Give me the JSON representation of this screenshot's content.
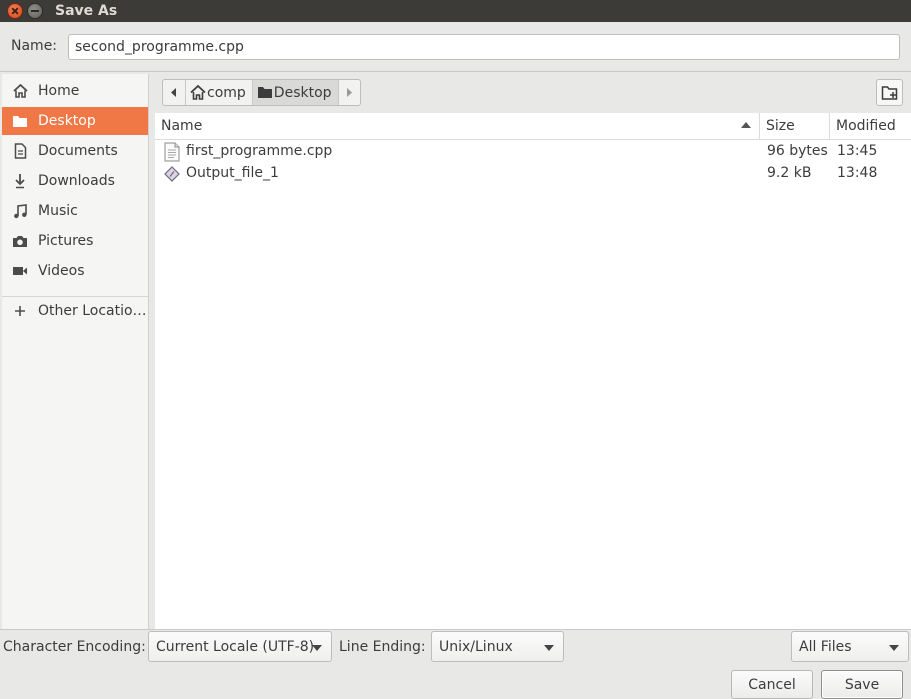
{
  "window": {
    "title": "Save As"
  },
  "name_field": {
    "label": "Name:",
    "value": "second_programme.cpp"
  },
  "sidebar": {
    "items": [
      {
        "label": "Home",
        "icon": "home-icon"
      },
      {
        "label": "Desktop",
        "icon": "folder-icon",
        "active": true
      },
      {
        "label": "Documents",
        "icon": "document-icon"
      },
      {
        "label": "Downloads",
        "icon": "download-icon"
      },
      {
        "label": "Music",
        "icon": "music-icon"
      },
      {
        "label": "Pictures",
        "icon": "camera-icon"
      },
      {
        "label": "Videos",
        "icon": "video-icon"
      },
      {
        "label": "Other Locatio…",
        "icon": "plus-icon"
      }
    ]
  },
  "pathbar": {
    "segments": [
      {
        "label": "comp",
        "icon": "home-icon"
      },
      {
        "label": "Desktop",
        "icon": "folder-icon",
        "current": true
      }
    ]
  },
  "file_list": {
    "columns": {
      "name": "Name",
      "size": "Size",
      "modified": "Modified"
    },
    "sort": "name-ascending",
    "rows": [
      {
        "name": "first_programme.cpp",
        "size": "96 bytes",
        "modified": "13:45",
        "icon": "text-file-icon"
      },
      {
        "name": "Output_file_1",
        "size": "9.2 kB",
        "modified": "13:48",
        "icon": "executable-icon"
      }
    ]
  },
  "footer": {
    "encoding_label": "Character Encoding:",
    "encoding_value": "Current Locale (UTF-8)",
    "line_ending_label": "Line Ending:",
    "line_ending_value": "Unix/Linux",
    "filter_value": "All Files",
    "cancel_label": "Cancel",
    "save_label": "Save"
  },
  "colors": {
    "accent": "#f07746",
    "titlebar": "#3c3b37"
  }
}
